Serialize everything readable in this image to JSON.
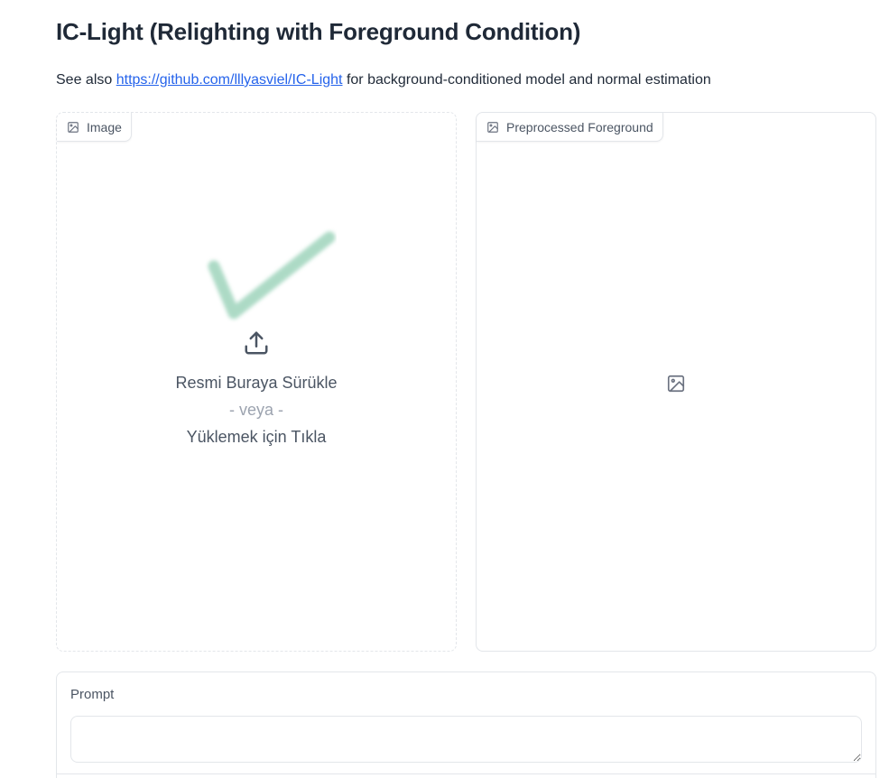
{
  "header": {
    "title": "IC-Light (Relighting with Foreground Condition)",
    "subtitle_prefix": "See also ",
    "subtitle_link": "https://github.com/lllyasviel/IC-Light",
    "subtitle_suffix": " for background-conditioned model and normal estimation"
  },
  "image_panel": {
    "label": "Image",
    "label_icon": "image-icon",
    "upload_icon": "upload-icon",
    "drop_text": "Resmi Buraya Sürükle",
    "or_text": "- veya -",
    "click_text": "Yüklemek için Tıkla"
  },
  "foreground_panel": {
    "label": "Preprocessed Foreground",
    "label_icon": "image-icon",
    "empty_icon": "image-placeholder-icon"
  },
  "prompt": {
    "label": "Prompt",
    "value": "",
    "placeholder": ""
  },
  "colors": {
    "link": "#2563eb",
    "border": "#e3e6ea",
    "checkmark": "#9fd4bc"
  }
}
